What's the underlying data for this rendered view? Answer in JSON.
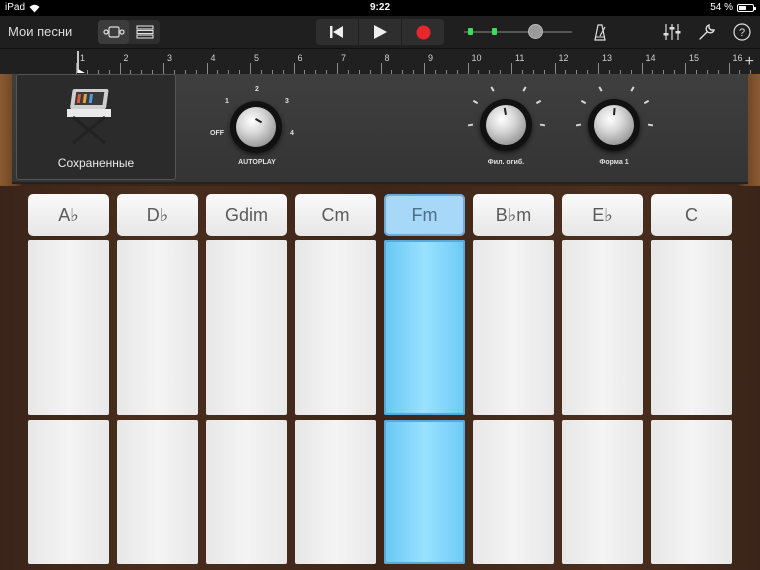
{
  "status_bar": {
    "device": "iPad",
    "time": "9:22",
    "battery": "54 %",
    "battery_fraction": 0.54
  },
  "toolbar": {
    "my_songs_label": "Мои песни",
    "view_modes": [
      "instrument-view-icon",
      "tracks-view-icon"
    ],
    "transport": [
      "rewind-icon",
      "play-icon",
      "record-icon"
    ],
    "tools": [
      "metronome-icon",
      "mixer-icon",
      "wrench-icon",
      "help-icon"
    ],
    "accent_record": "#e8262d",
    "meter_color": "#3ddc5a",
    "volume_level": 0.6
  },
  "ruler": {
    "bars": [
      "1",
      "2",
      "3",
      "4",
      "5",
      "6",
      "7",
      "8",
      "9",
      "10",
      "11",
      "12",
      "13",
      "14",
      "15",
      "16"
    ],
    "add_label": "+"
  },
  "instrument": {
    "preset_name": "Сохраненные",
    "autoplay": {
      "caption": "AUTOPLAY",
      "positions": [
        "OFF",
        "1",
        "2",
        "3",
        "4"
      ],
      "selected": "4"
    },
    "knobs": [
      {
        "caption": "Фил. огиб."
      },
      {
        "caption": "Форма 1"
      }
    ]
  },
  "chords": [
    {
      "label": "A♭",
      "active": false
    },
    {
      "label": "D♭",
      "active": false
    },
    {
      "label": "Gdim",
      "active": false
    },
    {
      "label": "Cm",
      "active": false
    },
    {
      "label": "Fm",
      "active": true
    },
    {
      "label": "B♭m",
      "active": false
    },
    {
      "label": "E♭",
      "active": false
    },
    {
      "label": "C",
      "active": false
    }
  ],
  "colors": {
    "active_strip": "#8fd8fb",
    "wood": "#4a2e1e"
  }
}
